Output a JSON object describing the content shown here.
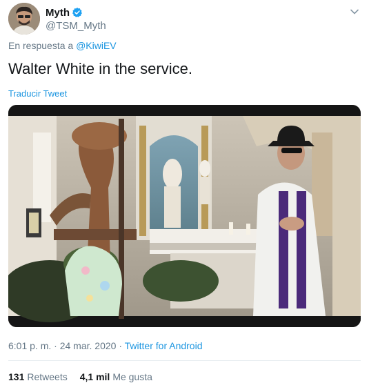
{
  "user": {
    "display_name": "Myth",
    "handle": "@TSM_Myth",
    "verified": true
  },
  "reply": {
    "prefix": "En respuesta a",
    "mention": "@KiwiEV"
  },
  "tweet": {
    "text": "Walter White in the service.",
    "translate_label": "Traducir Tweet"
  },
  "meta": {
    "time": "6:01 p. m.",
    "sep1": "·",
    "date": "24 mar. 2020",
    "sep2": "·",
    "source": "Twitter for Android"
  },
  "stats": {
    "retweets_count": "131",
    "retweets_label": "Retweets",
    "likes_count": "4,1 mil",
    "likes_label": "Me gusta"
  },
  "colors": {
    "link": "#1b95e0",
    "secondary": "#657786",
    "verified": "#1da1f2"
  },
  "icons": {
    "verified": "verified-badge-icon",
    "menu": "chevron-down-icon"
  }
}
